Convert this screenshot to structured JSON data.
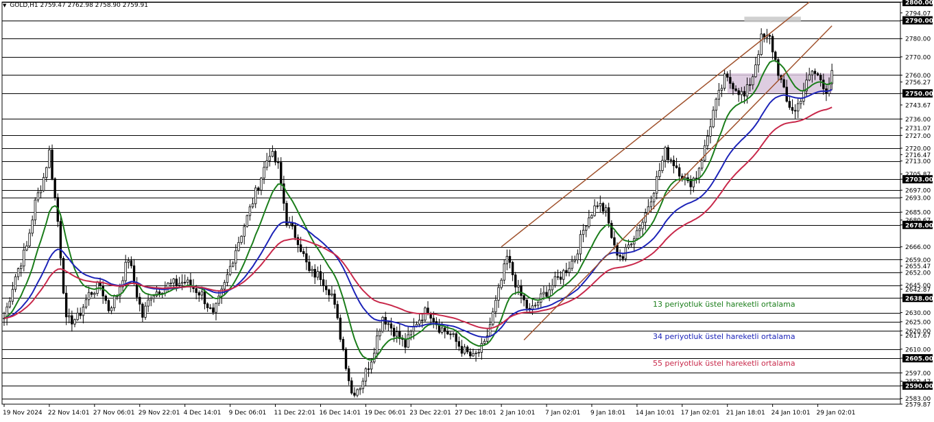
{
  "header": {
    "symbol": "GOLD,H1",
    "ohlc": "2759.47 2762.98 2758.90 2759.91"
  },
  "chart_data": {
    "type": "candlestick",
    "title": "GOLD,H1",
    "ylim": [
      2579.87,
      2800.0
    ],
    "y_ticks": [
      {
        "value": 2800.0,
        "label": "2800.00",
        "line": true,
        "boxed": true
      },
      {
        "value": 2794.07,
        "label": "2794.07",
        "line": false,
        "boxed": false
      },
      {
        "value": 2790.0,
        "label": "2790.00",
        "line": true,
        "boxed": true
      },
      {
        "value": 2780.0,
        "label": "2780.00",
        "line": true,
        "boxed": false
      },
      {
        "value": 2770.0,
        "label": "2770.00",
        "line": true,
        "boxed": false
      },
      {
        "value": 2760.0,
        "label": "2760.00",
        "line": true,
        "boxed": false
      },
      {
        "value": 2756.27,
        "label": "2756.27",
        "line": false,
        "boxed": false
      },
      {
        "value": 2750.0,
        "label": "2750.00",
        "line": true,
        "boxed": true
      },
      {
        "value": 2743.67,
        "label": "2743.67",
        "line": false,
        "boxed": false
      },
      {
        "value": 2736.0,
        "label": "2736.00",
        "line": true,
        "boxed": false
      },
      {
        "value": 2731.07,
        "label": "2731.07",
        "line": false,
        "boxed": false
      },
      {
        "value": 2727.0,
        "label": "2727.00",
        "line": true,
        "boxed": false
      },
      {
        "value": 2720.0,
        "label": "2720.00",
        "line": true,
        "boxed": false
      },
      {
        "value": 2716.47,
        "label": "2716.47",
        "line": false,
        "boxed": false
      },
      {
        "value": 2713.0,
        "label": "2713.00",
        "line": true,
        "boxed": false
      },
      {
        "value": 2705.87,
        "label": "2705.87",
        "line": false,
        "boxed": false
      },
      {
        "value": 2703.0,
        "label": "2703.00",
        "line": true,
        "boxed": true
      },
      {
        "value": 2697.0,
        "label": "2697.00",
        "line": true,
        "boxed": false
      },
      {
        "value": 2693.0,
        "label": "2693.00",
        "line": true,
        "boxed": false
      },
      {
        "value": 2685.0,
        "label": "2685.00",
        "line": true,
        "boxed": false
      },
      {
        "value": 2680.67,
        "label": "2680.67",
        "line": false,
        "boxed": false
      },
      {
        "value": 2678.0,
        "label": "2678.00",
        "line": true,
        "boxed": true
      },
      {
        "value": 2666.0,
        "label": "2666.00",
        "line": true,
        "boxed": false
      },
      {
        "value": 2659.0,
        "label": "2659.00",
        "line": true,
        "boxed": false
      },
      {
        "value": 2655.47,
        "label": "2655.47",
        "line": false,
        "boxed": false
      },
      {
        "value": 2652.0,
        "label": "2652.00",
        "line": true,
        "boxed": false
      },
      {
        "value": 2645.0,
        "label": "2645.00",
        "line": true,
        "boxed": false
      },
      {
        "value": 2642.87,
        "label": "2642.87",
        "line": false,
        "boxed": false
      },
      {
        "value": 2638.0,
        "label": "2638.00",
        "line": true,
        "boxed": true
      },
      {
        "value": 2630.0,
        "label": "2630.00",
        "line": true,
        "boxed": false
      },
      {
        "value": 2625.0,
        "label": "2625.00",
        "line": true,
        "boxed": false
      },
      {
        "value": 2620.0,
        "label": "2620.00",
        "line": true,
        "boxed": false
      },
      {
        "value": 2617.67,
        "label": "2617.67",
        "line": false,
        "boxed": false
      },
      {
        "value": 2610.0,
        "label": "2610.00",
        "line": true,
        "boxed": false
      },
      {
        "value": 2605.0,
        "label": "2605.00",
        "line": true,
        "boxed": true
      },
      {
        "value": 2597.0,
        "label": "2597.00",
        "line": true,
        "boxed": false
      },
      {
        "value": 2592.47,
        "label": "2592.47",
        "line": false,
        "boxed": false
      },
      {
        "value": 2590.0,
        "label": "2590.00",
        "line": true,
        "boxed": true
      },
      {
        "value": 2583.0,
        "label": "2583.00",
        "line": true,
        "boxed": false
      },
      {
        "value": 2579.87,
        "label": "2579.87",
        "line": false,
        "boxed": false
      }
    ],
    "x_ticks": [
      {
        "index": 0,
        "label": "19 Nov 2024"
      },
      {
        "index": 16,
        "label": "22 Nov 14:01"
      },
      {
        "index": 32,
        "label": "27 Nov 06:01"
      },
      {
        "index": 48,
        "label": "29 Nov 22:01"
      },
      {
        "index": 64,
        "label": "4 Dec 14:01"
      },
      {
        "index": 80,
        "label": "9 Dec 06:01"
      },
      {
        "index": 96,
        "label": "11 Dec 22:01"
      },
      {
        "index": 112,
        "label": "16 Dec 14:01"
      },
      {
        "index": 128,
        "label": "19 Dec 06:01"
      },
      {
        "index": 144,
        "label": "23 Dec 22:01"
      },
      {
        "index": 160,
        "label": "27 Dec 18:01"
      },
      {
        "index": 176,
        "label": "2 Jan 10:01"
      },
      {
        "index": 192,
        "label": "7 Jan 02:01"
      },
      {
        "index": 208,
        "label": "9 Jan 18:01"
      },
      {
        "index": 224,
        "label": "14 Jan 10:01"
      },
      {
        "index": 240,
        "label": "17 Jan 02:01"
      },
      {
        "index": 256,
        "label": "21 Jan 18:01"
      },
      {
        "index": 272,
        "label": "24 Jan 10:01"
      },
      {
        "index": 288,
        "label": "29 Jan 02:01"
      }
    ],
    "candle_count": 294,
    "candle_color": "#000000",
    "anchors": [
      [
        0,
        2627
      ],
      [
        4,
        2650
      ],
      [
        8,
        2666
      ],
      [
        11,
        2690
      ],
      [
        14,
        2704
      ],
      [
        16,
        2718
      ],
      [
        19,
        2680
      ],
      [
        22,
        2625
      ],
      [
        26,
        2627
      ],
      [
        30,
        2640
      ],
      [
        34,
        2645
      ],
      [
        37,
        2632
      ],
      [
        40,
        2640
      ],
      [
        44,
        2660
      ],
      [
        47,
        2640
      ],
      [
        49,
        2628
      ],
      [
        52,
        2640
      ],
      [
        58,
        2645
      ],
      [
        64,
        2647
      ],
      [
        70,
        2640
      ],
      [
        74,
        2628
      ],
      [
        78,
        2645
      ],
      [
        82,
        2665
      ],
      [
        86,
        2682
      ],
      [
        90,
        2700
      ],
      [
        94,
        2718
      ],
      [
        97,
        2710
      ],
      [
        100,
        2680
      ],
      [
        104,
        2670
      ],
      [
        108,
        2652
      ],
      [
        112,
        2650
      ],
      [
        116,
        2640
      ],
      [
        120,
        2610
      ],
      [
        123,
        2586
      ],
      [
        126,
        2590
      ],
      [
        130,
        2605
      ],
      [
        134,
        2628
      ],
      [
        138,
        2620
      ],
      [
        142,
        2612
      ],
      [
        146,
        2625
      ],
      [
        150,
        2632
      ],
      [
        154,
        2622
      ],
      [
        158,
        2618
      ],
      [
        162,
        2610
      ],
      [
        166,
        2605
      ],
      [
        170,
        2612
      ],
      [
        174,
        2635
      ],
      [
        178,
        2660
      ],
      [
        182,
        2642
      ],
      [
        186,
        2630
      ],
      [
        190,
        2638
      ],
      [
        194,
        2645
      ],
      [
        198,
        2652
      ],
      [
        202,
        2660
      ],
      [
        206,
        2680
      ],
      [
        210,
        2690
      ],
      [
        213,
        2685
      ],
      [
        216,
        2665
      ],
      [
        219,
        2660
      ],
      [
        222,
        2670
      ],
      [
        226,
        2680
      ],
      [
        230,
        2698
      ],
      [
        234,
        2718
      ],
      [
        238,
        2710
      ],
      [
        242,
        2700
      ],
      [
        245,
        2705
      ],
      [
        248,
        2720
      ],
      [
        251,
        2740
      ],
      [
        255,
        2758
      ],
      [
        258,
        2755
      ],
      [
        262,
        2748
      ],
      [
        265,
        2760
      ],
      [
        268,
        2780
      ],
      [
        271,
        2780
      ],
      [
        274,
        2762
      ],
      [
        277,
        2745
      ],
      [
        280,
        2740
      ],
      [
        283,
        2752
      ],
      [
        286,
        2762
      ],
      [
        289,
        2758
      ],
      [
        291,
        2752
      ],
      [
        293,
        2760
      ]
    ],
    "ema_series": [
      {
        "name": "13 periyotluk üstel hareketli ortalama",
        "period": 13,
        "color": "#1a7d1a"
      },
      {
        "name": "34 periyotluk üstel hareketli ortalama",
        "period": 34,
        "color": "#1c23b8"
      },
      {
        "name": "55 periyotluk üstel hareketli ortalama",
        "period": 55,
        "color": "#c8284a"
      }
    ],
    "channel_lines": [
      {
        "color": "#a0522d",
        "from": {
          "index": 176,
          "value": 2666
        },
        "to": {
          "index": 285,
          "value": 2800
        }
      },
      {
        "color": "#a0522d",
        "from": {
          "index": 184,
          "value": 2615
        },
        "to": {
          "index": 293,
          "value": 2787
        }
      }
    ],
    "zones": [
      {
        "color": "#d8c4dc",
        "from": {
          "index": 256,
          "value": 2761
        },
        "to": {
          "index": 293,
          "value": 2750
        }
      },
      {
        "color": "#c8c8c8",
        "from": {
          "index": 262,
          "value": 2792
        },
        "to": {
          "index": 282,
          "value": 2789
        }
      }
    ],
    "legend_position": "bottom-right"
  }
}
